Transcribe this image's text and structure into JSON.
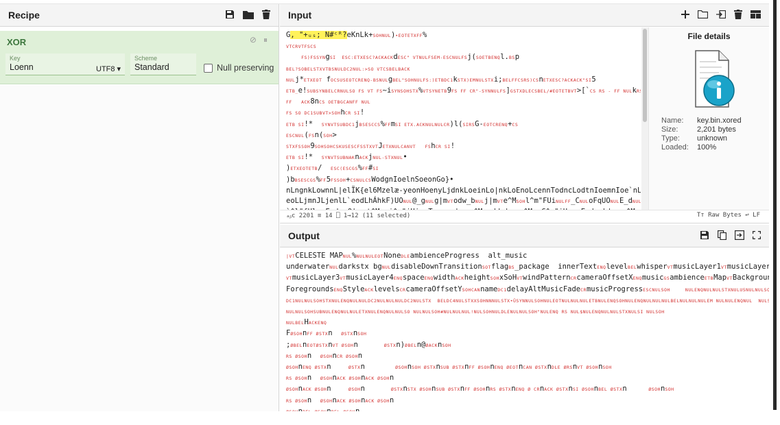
{
  "recipe": {
    "title": "Recipe",
    "operation": {
      "name": "XOR",
      "key_label": "Key",
      "key_value": "Loenn",
      "key_encoding": "UTF8 ▾",
      "scheme_label": "Scheme",
      "scheme_value": "Standard",
      "null_preserving_label": "Null preserving",
      "disable_glyph": "⊘",
      "pause_glyph": "⏸"
    }
  },
  "input": {
    "title": "Input",
    "status_left": "ₐᵦc 2201  ≡ 14  ⎕ 1→12 (11 selected)",
    "status_right": "Tт Raw Bytes  ↩ LF"
  },
  "file_details": {
    "title": "File details",
    "name_label": "Name:",
    "name_value": "key.bin.xored",
    "size_label": "Size:",
    "size_value": "2,201 bytes",
    "type_label": "Type:",
    "type_value": "unknown",
    "loaded_label": "Loaded:",
    "loaded_value": "100%"
  },
  "output": {
    "title": "Output"
  },
  "icons": {
    "save": "save-icon",
    "folder": "folder-icon",
    "trash": "trash-icon",
    "plus": "plus-icon",
    "folder_open": "folder-open-icon",
    "import": "import-icon",
    "layout": "layout-icon",
    "copy": "copy-icon",
    "replace": "replace-input-icon",
    "maximize": "maximize-icon"
  },
  "colors": {
    "op_bg": "#dff0d8",
    "op_text": "#3c763d",
    "control_char": "#d3302f",
    "highlight": "#fff25a"
  }
}
